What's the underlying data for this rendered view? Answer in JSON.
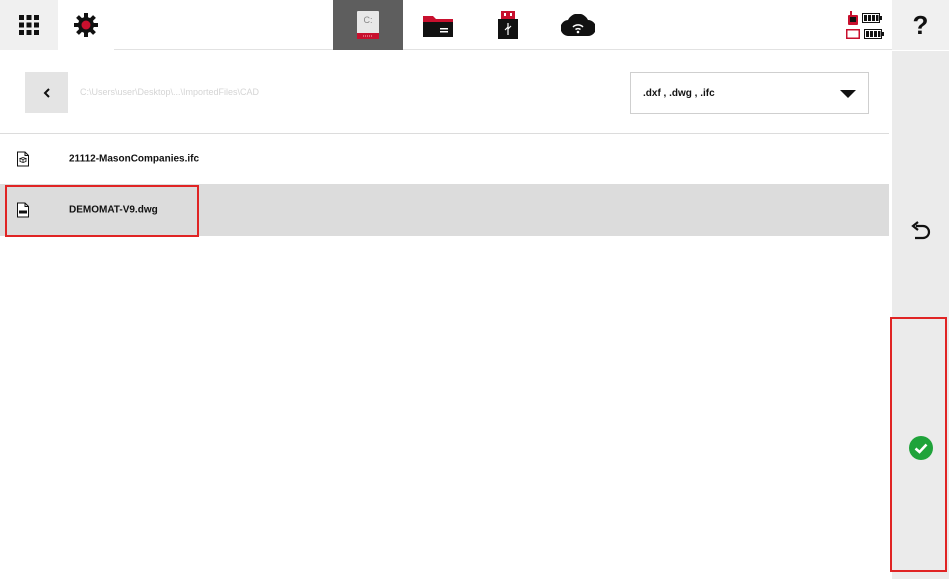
{
  "topbar": {
    "apps_icon": "grid-icon",
    "settings_icon": "gear-icon",
    "sources": [
      {
        "name": "drive-c",
        "label": "C:",
        "active": true
      },
      {
        "name": "folder",
        "icon": "folder-icon"
      },
      {
        "name": "usb",
        "icon": "usb-icon"
      },
      {
        "name": "cloud",
        "icon": "wifi-cloud-icon"
      }
    ],
    "status": {
      "device_icon": "remote-icon",
      "tablet_icon": "tablet-icon"
    },
    "help_label": "?"
  },
  "path": {
    "back_icon": "chevron-left-icon",
    "current_path": "C:\\Users\\user\\Desktop\\...\\ImportedFiles\\CAD",
    "filter_value": ".dxf , .dwg , .ifc"
  },
  "files": [
    {
      "name": "21112-MasonCompanies.ifc",
      "icon": "ifc-file-icon",
      "selected": false
    },
    {
      "name": "DEMOMAT-V9.dwg",
      "icon": "dwg-file-icon",
      "selected": true
    }
  ],
  "sidebar": {
    "undo_icon": "undo-icon",
    "confirm_icon": "check-circle-icon"
  },
  "colors": {
    "accent": "#c8102e",
    "highlight": "#e02424",
    "confirm": "#1fa33a"
  }
}
